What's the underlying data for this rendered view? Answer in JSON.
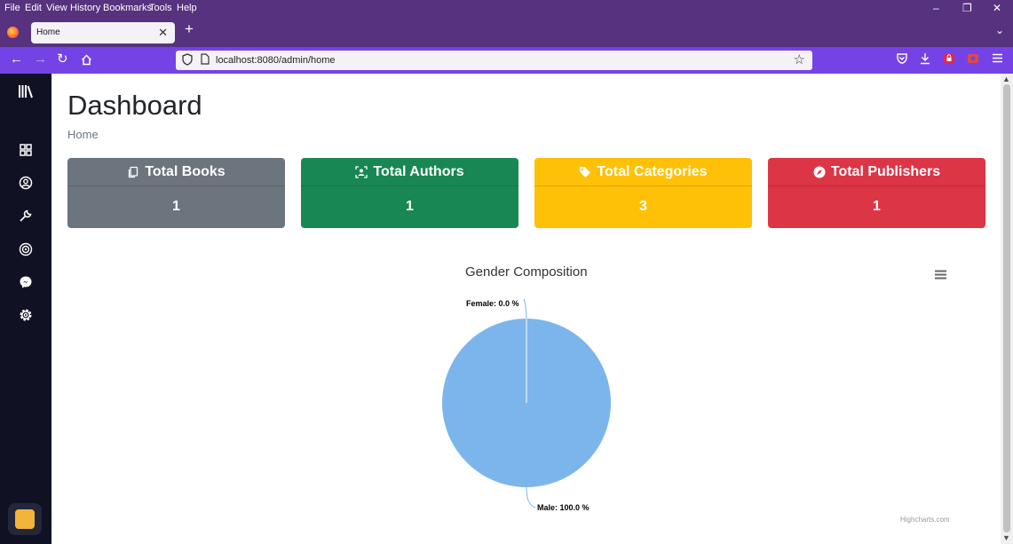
{
  "browser": {
    "menu": [
      "File",
      "Edit",
      "View",
      "History",
      "Bookmarks",
      "Tools",
      "Help"
    ],
    "window_controls": [
      "–",
      "❐",
      "✕"
    ],
    "tab": {
      "title": "Home",
      "close": "✕"
    },
    "new_tab": "+",
    "tab_list": "⌄",
    "nav": {
      "back": "←",
      "forward": "→",
      "reload": "↻"
    },
    "url": "localhost:8080/admin/home",
    "bookmark_star": "☆"
  },
  "sidebar": {
    "items": [
      "dashboard",
      "profile",
      "tools",
      "broadcast",
      "messenger",
      "settings"
    ]
  },
  "main": {
    "title": "Dashboard",
    "breadcrumb": "Home",
    "cards": [
      {
        "label": "Total Books",
        "value": "1",
        "color": "#6c757d",
        "icon": "copy-icon"
      },
      {
        "label": "Total Authors",
        "value": "1",
        "color": "#198754",
        "icon": "author-icon"
      },
      {
        "label": "Total Categories",
        "value": "3",
        "color": "#ffc107",
        "icon": "tags-icon"
      },
      {
        "label": "Total Publishers",
        "value": "1",
        "color": "#dc3545",
        "icon": "compass-icon"
      }
    ]
  },
  "chart_data": {
    "type": "pie",
    "title": "Gender Composition",
    "slices": [
      {
        "name": "Female",
        "value": 0.0,
        "label": "Female: 0.0 %"
      },
      {
        "name": "Male",
        "value": 100.0,
        "label": "Male: 100.0 %"
      }
    ],
    "color": "#7cb5ec",
    "credits": "Highcharts.com"
  }
}
